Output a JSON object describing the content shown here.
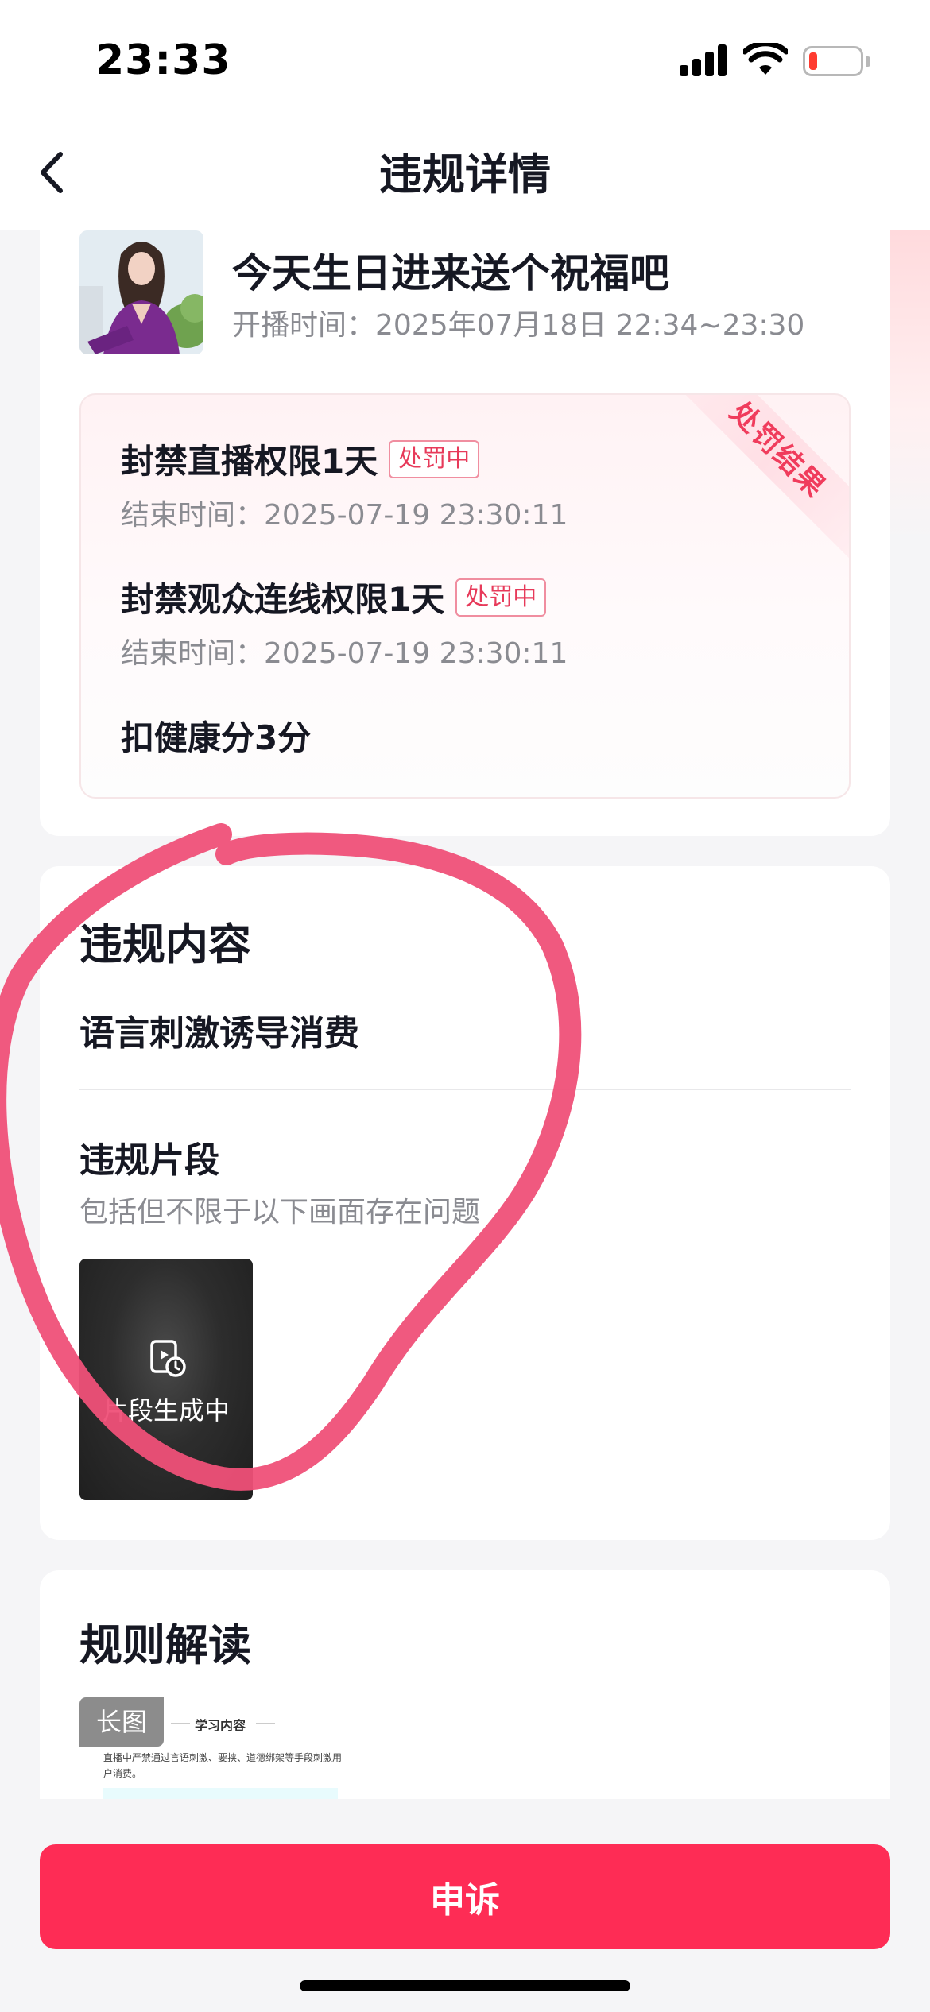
{
  "status_bar": {
    "time": "23:33"
  },
  "nav": {
    "title": "违规详情"
  },
  "live": {
    "title": "今天生日进来送个祝福吧",
    "time": "开播时间：2025年07月18日 22:34~23:30"
  },
  "penalty": {
    "ribbon": "处罚结果",
    "items": [
      {
        "title": "封禁直播权限1天",
        "tag": "处罚中",
        "end_time": "结束时间：2025-07-19 23:30:11"
      },
      {
        "title": "封禁观众连线权限1天",
        "tag": "处罚中",
        "end_time": "结束时间：2025-07-19 23:30:11"
      }
    ],
    "health": "扣健康分3分"
  },
  "violation": {
    "section_title": "违规内容",
    "content": "语言刺激诱导消费",
    "clip_title": "违规片段",
    "clip_hint": "包括但不限于以下画面存在问题",
    "clip_status": "片段生成中"
  },
  "rules": {
    "section_title": "规则解读",
    "image_tag": "长图",
    "image_heading": "学习内容",
    "image_text": "直播中严禁通过言语刺激、要挟、道德绑架等手段刺激用户消费。"
  },
  "appeal": {
    "label": "申诉",
    "color": "#fe2c55"
  },
  "annotation_color": "#ef5078"
}
